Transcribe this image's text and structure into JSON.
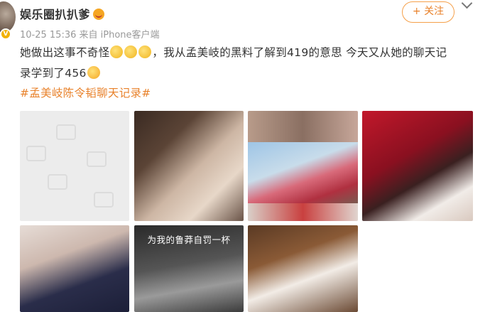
{
  "post": {
    "username": "娱乐圈扒扒爹",
    "verified_badge": "V",
    "timestamp": "10-25 15:36",
    "source": "来自 iPhone客户端",
    "follow_label": "+ 关注",
    "text_part1": "她做出这事不奇怪",
    "text_part2": "，我从孟美岐的黑料了解到419的意思 今天又从她的聊天记",
    "text_part3": "录学到了456",
    "hashtag": "#孟美岐陈令韬聊天记录#"
  },
  "photos": [
    {
      "name": "photo-placeholder"
    },
    {
      "name": "photo-portrait-woman"
    },
    {
      "name": "photo-collage-red-hair"
    },
    {
      "name": "photo-red-background-portrait"
    },
    {
      "name": "photo-dark-velvet"
    },
    {
      "name": "photo-bw-drinking",
      "caption": "为我的鲁莽自罚一杯"
    },
    {
      "name": "photo-restaurant-selfie"
    }
  ],
  "colors": {
    "accent": "#e8812a",
    "text": "#333333",
    "meta": "#999999"
  }
}
